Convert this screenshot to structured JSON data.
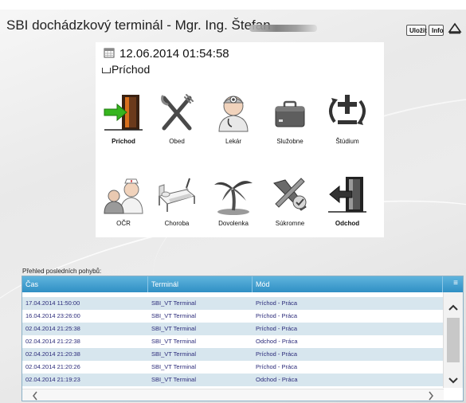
{
  "window": {
    "title": "SBI dochádzkový terminál - Mgr. Ing. Štefan",
    "save_label": "Uložit",
    "info_label": "Info"
  },
  "status": {
    "datetime": "12.06.2014 01:54:58",
    "mode": "Príchod"
  },
  "actions": [
    {
      "label": "Príchod",
      "icon": "door-enter-icon",
      "bold": true
    },
    {
      "label": "Obed",
      "icon": "fork-knife-icon",
      "bold": false
    },
    {
      "label": "Lekár",
      "icon": "doctor-icon",
      "bold": false
    },
    {
      "label": "Služobne",
      "icon": "briefcase-icon",
      "bold": false
    },
    {
      "label": "Štúdium",
      "icon": "plus-arrows-icon",
      "bold": false
    },
    {
      "label": "OČR",
      "icon": "nurse-child-icon",
      "bold": false
    },
    {
      "label": "Choroba",
      "icon": "sickbed-icon",
      "bold": false
    },
    {
      "label": "Dovolenka",
      "icon": "palm-island-icon",
      "bold": false
    },
    {
      "label": "Súkromne",
      "icon": "tools-crossed-icon",
      "bold": false
    },
    {
      "label": "Odchod",
      "icon": "door-exit-icon",
      "bold": true
    }
  ],
  "history": {
    "title": "Přehled posledních pohybů:",
    "columns": [
      "Čas",
      "Terminál",
      "Mód"
    ],
    "rows": [
      [
        "17.04.2014 11:50:00",
        "SBI_VT Terminal",
        "Príchod - Práca"
      ],
      [
        "16.04.2014 23:26:00",
        "SBI_VT Terminal",
        "Príchod - Práca"
      ],
      [
        "02.04.2014 21:25:38",
        "SBI_VT Terminal",
        "Príchod - Práca"
      ],
      [
        "02.04.2014 21:22:38",
        "SBI_VT Terminal",
        "Odchod - Práca"
      ],
      [
        "02.04.2014 21:20:38",
        "SBI_VT Terminal",
        "Príchod - Práca"
      ],
      [
        "02.04.2014 21:20:26",
        "SBI_VT Terminal",
        "Príchod - Práca"
      ],
      [
        "02.04.2014 21:19:23",
        "SBI_VT Terminal",
        "Odchod - Práca"
      ]
    ]
  },
  "colors": {
    "header_blue": "#3a9bd0",
    "row_alt": "#d7e6ee",
    "row_text": "#2b2b7a"
  }
}
